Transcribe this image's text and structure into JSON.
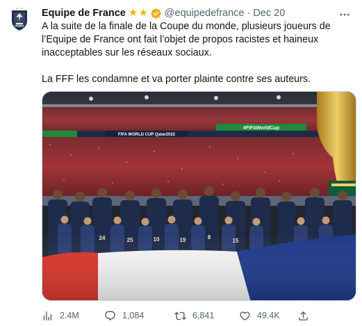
{
  "tweet": {
    "author": {
      "display_name": "Equipe de France",
      "badges": [
        "star-icon",
        "star-icon"
      ],
      "verified": true,
      "handle": "@equipedefrance",
      "avatar_text": "FRANCE"
    },
    "separator": "·",
    "date": "Dec 20",
    "text_paragraphs": [
      "A la suite de la finale de la Coupe du monde, plusieurs joueurs de l’Equipe de France ont fait l’objet de propos racistes et haineux inacceptables sur les réseaux sociaux.",
      "La FFF les condamne et va porter plainte contre ses auteurs."
    ],
    "media": {
      "type": "photo",
      "description_icon": "team-lineup-photo",
      "banner_texts": [
        "FIFA WORLD CUP Qatar2022",
        "#FIFAWorldCup"
      ],
      "jersey_numbers": [
        "24",
        "25",
        "10",
        "19",
        "8",
        "15"
      ]
    },
    "stats": {
      "views": "2.4M",
      "replies": "1,084",
      "retweets": "6,841",
      "likes": "49.4K"
    },
    "more_icon": "more-dots-icon",
    "colors": {
      "text_primary": "#0f1419",
      "text_secondary": "#536471",
      "badge_gold": "#f2b705",
      "verified_gold": "#e8b022",
      "france_blue": "#21304f"
    }
  }
}
